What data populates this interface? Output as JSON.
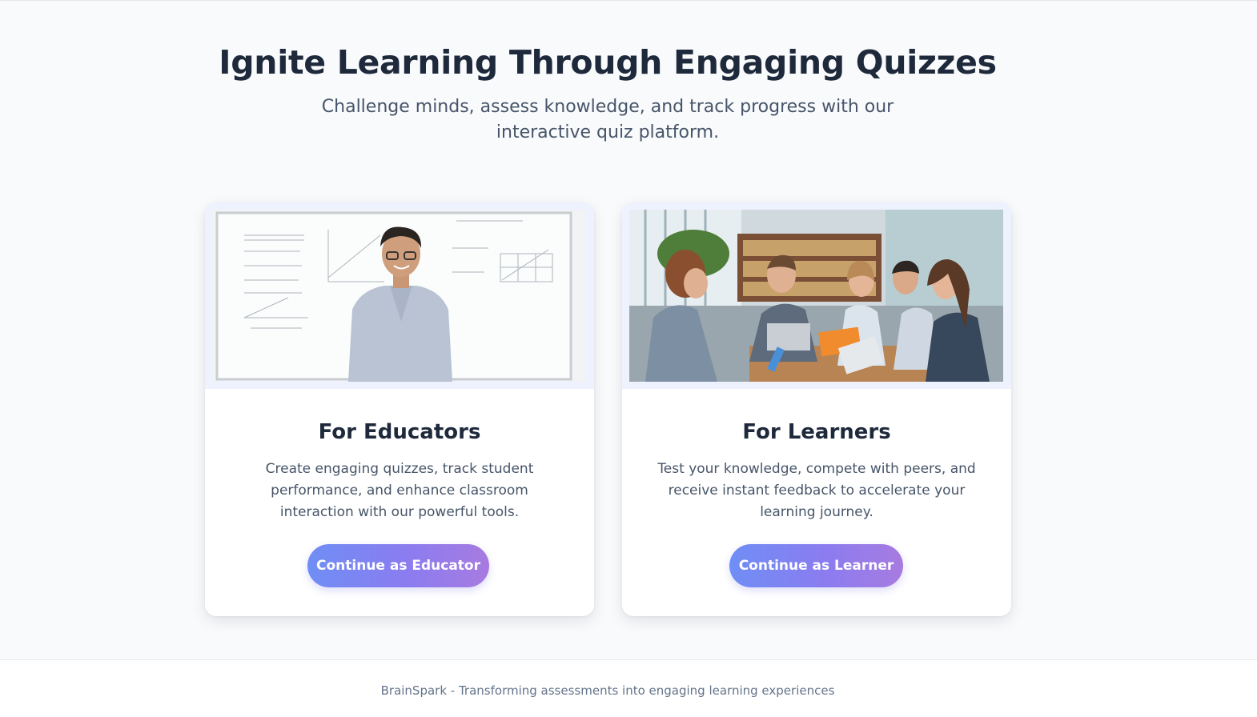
{
  "hero": {
    "title": "Ignite Learning Through Engaging Quizzes",
    "subtitle": "Challenge minds, assess knowledge, and track progress with our interactive quiz platform."
  },
  "cards": [
    {
      "role": "educator",
      "image_icon": "teacher-at-whiteboard-image",
      "title": "For Educators",
      "description": "Create engaging quizzes, track student performance, and enhance classroom interaction with our powerful tools.",
      "button_label": "Continue as Educator"
    },
    {
      "role": "learner",
      "image_icon": "students-with-laptops-image",
      "title": "For Learners",
      "description": "Test your knowledge, compete with peers, and receive instant feedback to accelerate your learning journey.",
      "button_label": "Continue as Learner"
    }
  ],
  "footer": {
    "text": "BrainSpark - Transforming assessments into engaging learning experiences"
  },
  "colors": {
    "heading": "#1e293b",
    "body_text": "#475569",
    "button_gradient_start": "#6f8ef5",
    "button_gradient_end": "#a77be0",
    "image_frame": "#eef2ff"
  }
}
